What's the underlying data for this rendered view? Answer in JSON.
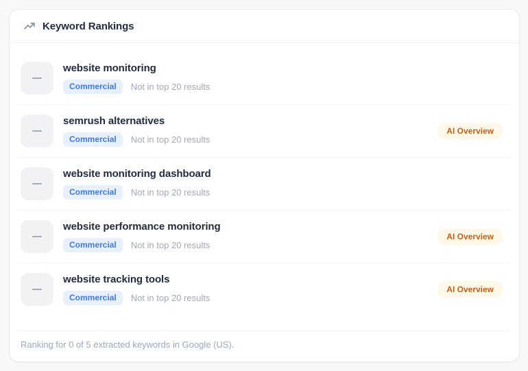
{
  "card": {
    "title": "Keyword Rankings",
    "footer": "Ranking for 0 of 5 extracted keywords in Google (US)."
  },
  "labels": {
    "ai_overview": "AI Overview"
  },
  "keywords": [
    {
      "title": "website monitoring",
      "intent": "Commercial",
      "status": "Not in top 20 results",
      "ai_overview": false
    },
    {
      "title": "semrush alternatives",
      "intent": "Commercial",
      "status": "Not in top 20 results",
      "ai_overview": true
    },
    {
      "title": "website monitoring dashboard",
      "intent": "Commercial",
      "status": "Not in top 20 results",
      "ai_overview": false
    },
    {
      "title": "website performance monitoring",
      "intent": "Commercial",
      "status": "Not in top 20 results",
      "ai_overview": true
    },
    {
      "title": "website tracking tools",
      "intent": "Commercial",
      "status": "Not in top 20 results",
      "ai_overview": true
    }
  ],
  "colors": {
    "page_background": "#f7f8fa",
    "card_background": "#ffffff",
    "title_text": "#232b3e",
    "intent_badge_bg": "#e9f0fd",
    "intent_badge_text": "#3d7ae5",
    "ai_badge_bg": "#fdf8e7",
    "ai_badge_text": "#c2611c",
    "muted_text": "#a2a8b4",
    "placeholder_bg": "#f1f2f4"
  }
}
